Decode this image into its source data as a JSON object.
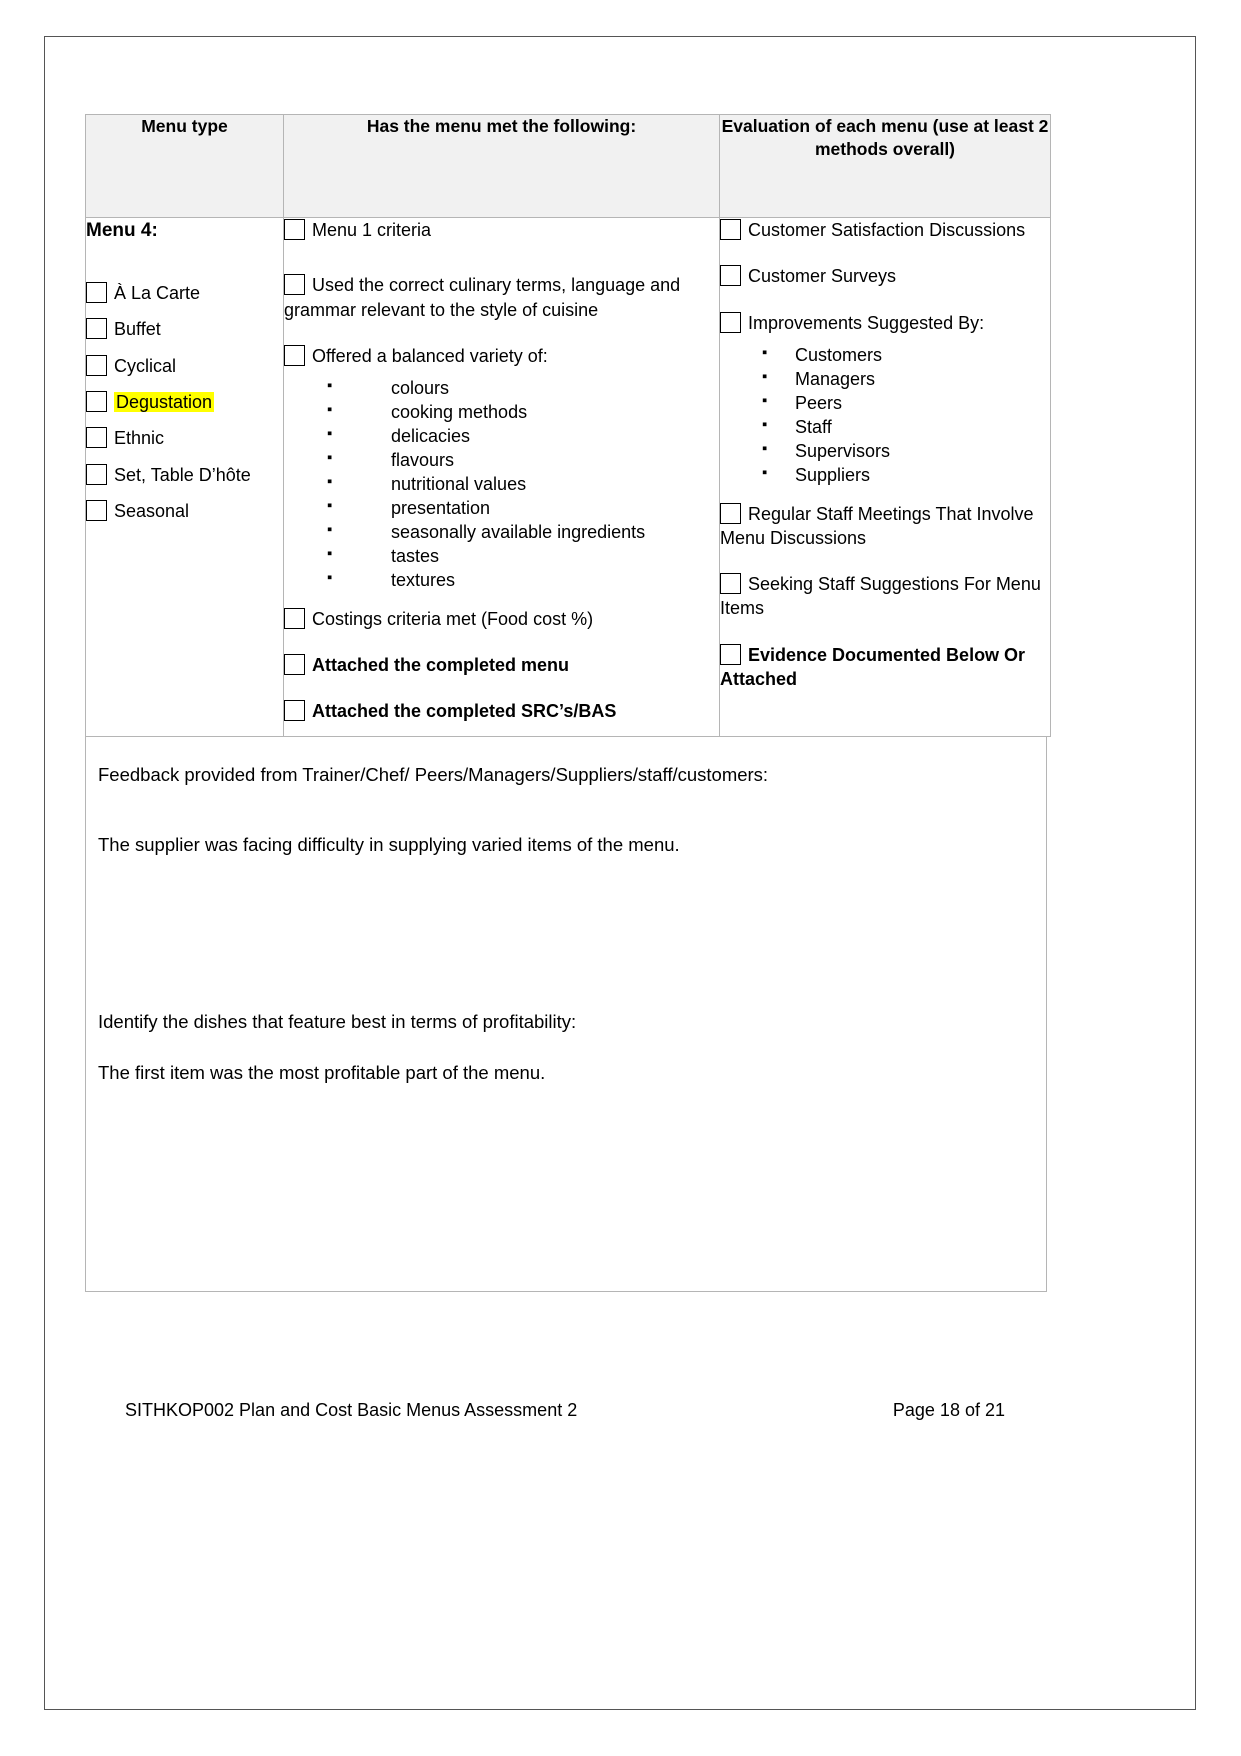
{
  "table": {
    "headers": {
      "col_a": "Menu type",
      "col_b": "Has the menu met the following:",
      "col_c": "Evaluation of each menu (use at least 2 methods overall)"
    },
    "menu_type": {
      "title": "Menu 4:",
      "options": [
        "À La Carte",
        "Buffet",
        "Cyclical",
        "Degustation",
        "Ethnic",
        "Set, Table D’hôte",
        "Seasonal"
      ],
      "highlighted_option": "Degustation",
      "highlight_color": "#ffff00"
    },
    "criteria": {
      "item1": "Menu 1 criteria",
      "item2": "Used the correct culinary terms, language and grammar relevant to the style of cuisine",
      "item3": "Offered a balanced variety of:",
      "variety_list": [
        "colours",
        "cooking methods",
        "delicacies",
        "flavours",
        "nutritional values",
        "presentation",
        "seasonally available ingredients",
        "tastes",
        "textures"
      ],
      "item4": "Costings criteria met (Food cost %)",
      "item5": "Attached the completed menu",
      "item6": "Attached the completed SRC’s/BAS"
    },
    "evaluation": {
      "item1": "Customer Satisfaction Discussions",
      "item2": "Customer Surveys",
      "item3": "Improvements Suggested By:",
      "suggested_by_list": [
        "Customers",
        "Managers",
        "Peers",
        "Staff",
        "Supervisors",
        "Suppliers"
      ],
      "item4": "Regular Staff Meetings That Involve Menu Discussions",
      "item5": "Seeking Staff Suggestions For Menu Items",
      "item6": "Evidence Documented Below Or Attached"
    }
  },
  "feedback": {
    "question1": "Feedback provided from Trainer/Chef/ Peers/Managers/Suppliers/staff/customers:",
    "answer1": "The supplier was facing difficulty in supplying varied items of the menu.",
    "question2": "Identify the dishes that feature best in terms of profitability:",
    "answer2": "The first item was the most profitable part of the menu."
  },
  "footer": {
    "document_title": "SITHKOP002 Plan and Cost Basic Menus Assessment 2",
    "page_number": "Page 18 of 21"
  }
}
